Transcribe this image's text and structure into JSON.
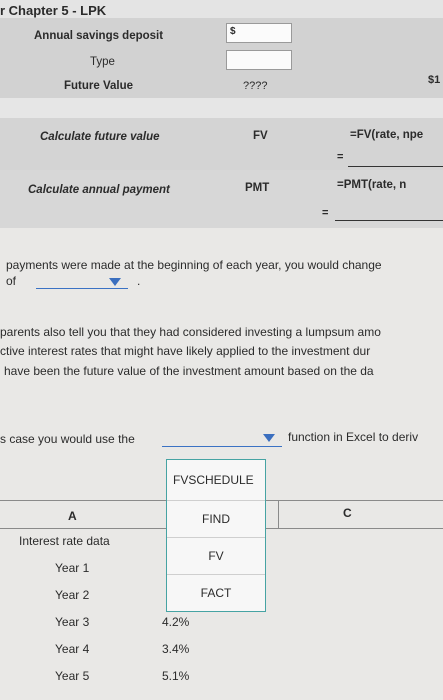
{
  "header": {
    "title": "r Chapter 5 - LPK"
  },
  "inputs": {
    "annual_savings_label": "Annual savings deposit",
    "annual_savings_currency": "$",
    "type_label": "Type",
    "future_value_label": "Future Value",
    "future_value_value": "????",
    "future_value_right": "$1"
  },
  "calc_fv": {
    "label": "Calculate future value",
    "fn": "FV",
    "formula": "=FV(rate, npe",
    "eq": "="
  },
  "calc_pmt": {
    "label": "Calculate annual payment",
    "fn": "PMT",
    "formula": "=PMT(rate, n",
    "eq": "="
  },
  "question1": {
    "line1": "payments were made at the beginning of each year, you would change",
    "line2": "of",
    "end": "."
  },
  "paragraph": {
    "line1": "parents also tell you that they had considered investing a lumpsum amo",
    "line2": "ctive interest rates that might have likely applied to the investment dur",
    "line3": "have been the future value of the investment amount based on the da"
  },
  "question2": {
    "pre": "s case you would use the",
    "post": "function in Excel to deriv"
  },
  "dropdown": {
    "options": [
      "FVSCHEDULE",
      "FIND",
      "FV",
      "FACT"
    ]
  },
  "table": {
    "col_a": "A",
    "col_c": "C",
    "section": "Interest rate data",
    "rows": [
      {
        "label": "Year 1",
        "value": ""
      },
      {
        "label": "Year 2",
        "value": ""
      },
      {
        "label": "Year 3",
        "value": "4.2%"
      },
      {
        "label": "Year 4",
        "value": "3.4%"
      },
      {
        "label": "Year 5",
        "value": "5.1%"
      }
    ]
  },
  "colors": {
    "accent_underline": "#3b72c4",
    "menu_border": "#46a3a3"
  }
}
